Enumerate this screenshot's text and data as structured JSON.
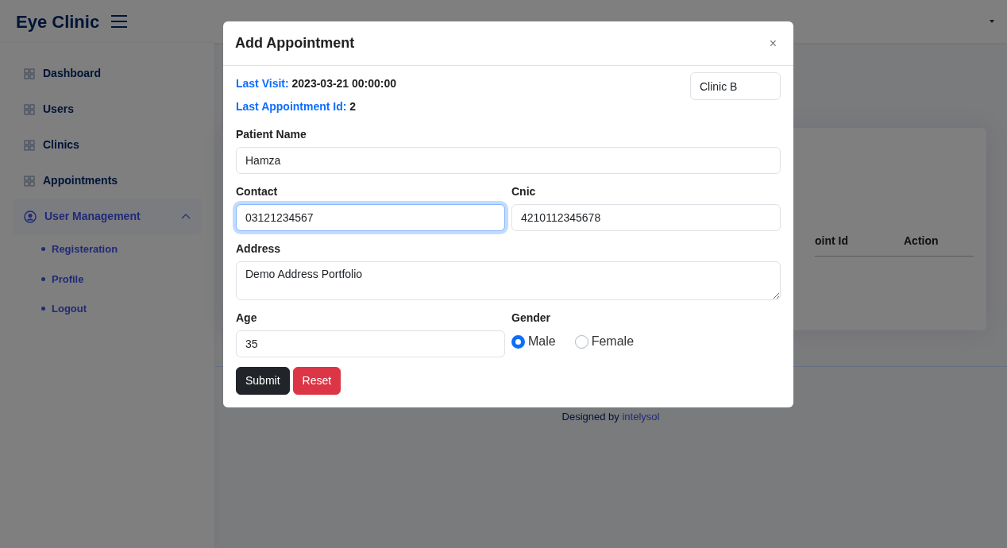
{
  "app": {
    "title": "Eye Clinic"
  },
  "sidebar": {
    "items": [
      {
        "label": "Dashboard",
        "kind": "link",
        "selected": false
      },
      {
        "label": "Users",
        "kind": "link",
        "selected": false
      },
      {
        "label": "Clinics",
        "kind": "link",
        "selected": false
      },
      {
        "label": "Appointments",
        "kind": "link",
        "selected": false
      },
      {
        "label": "User Management",
        "kind": "group",
        "selected": true,
        "expanded": true,
        "children": [
          {
            "label": "Registeration"
          },
          {
            "label": "Profile"
          },
          {
            "label": "Logout"
          }
        ]
      }
    ]
  },
  "table": {
    "columns": [
      "oint Id",
      "Action"
    ]
  },
  "footer": {
    "text": "Designed by",
    "link": "intelysol"
  },
  "modal": {
    "title": "Add Appointment",
    "close": "×",
    "info": [
      {
        "label": "Last Visit:",
        "value": "2023-03-21 00:00:00"
      },
      {
        "label": "Last Appointment Id:",
        "value": "2"
      }
    ],
    "clinic": "Clinic B",
    "rows": [
      [
        {
          "kind": "text",
          "label": "Patient Name",
          "value": "Hamza",
          "focused": false
        }
      ],
      [
        {
          "kind": "text",
          "label": "Contact",
          "value": "03121234567",
          "focused": true
        },
        {
          "kind": "text",
          "label": "Cnic",
          "value": "4210112345678",
          "focused": false
        }
      ],
      [
        {
          "kind": "textarea",
          "label": "Address",
          "value": "Demo Address Portfolio",
          "focused": false
        }
      ],
      [
        {
          "kind": "text",
          "label": "Age",
          "value": "35",
          "focused": false
        },
        {
          "kind": "radio",
          "label": "Gender",
          "options": [
            {
              "label": "Male",
              "selected": true
            },
            {
              "label": "Female",
              "selected": false
            }
          ]
        }
      ]
    ],
    "buttons": [
      {
        "label": "Submit",
        "kind": "primary"
      },
      {
        "label": "Reset",
        "kind": "danger"
      }
    ]
  }
}
